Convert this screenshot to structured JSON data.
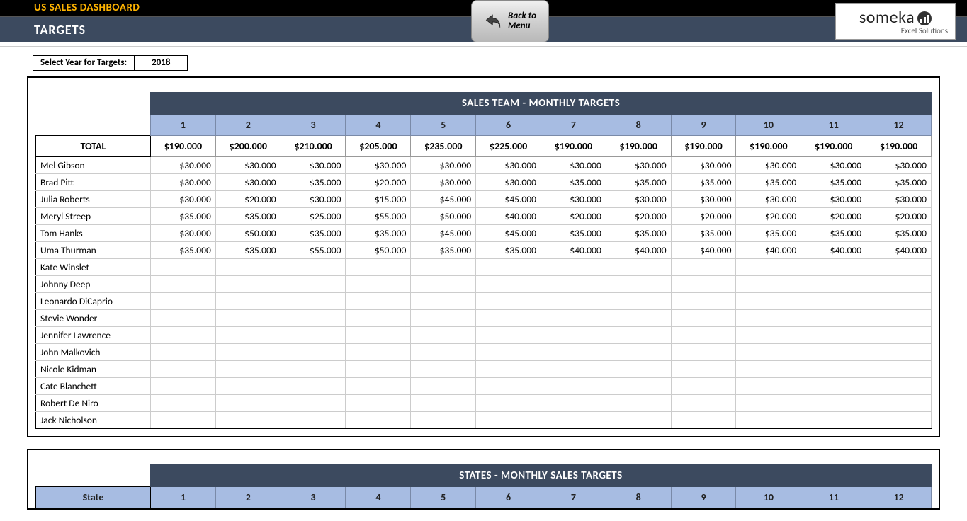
{
  "header": {
    "title": "US SALES DASHBOARD",
    "subtitle": "TARGETS",
    "back_button_line1": "Back to",
    "back_button_line2": "Menu",
    "logo_name": "someka",
    "logo_tagline": "Excel Solutions"
  },
  "year_selector": {
    "label": "Select Year for Targets:",
    "value": "2018"
  },
  "table1": {
    "title": "SALES TEAM - MONTHLY TARGETS",
    "months": [
      "1",
      "2",
      "3",
      "4",
      "5",
      "6",
      "7",
      "8",
      "9",
      "10",
      "11",
      "12"
    ],
    "total_label": "TOTAL",
    "totals": [
      "$190.000",
      "$200.000",
      "$210.000",
      "$205.000",
      "$235.000",
      "$225.000",
      "$190.000",
      "$190.000",
      "$190.000",
      "$190.000",
      "$190.000",
      "$190.000"
    ],
    "rows": [
      {
        "name": "Mel Gibson",
        "vals": [
          "$30.000",
          "$30.000",
          "$30.000",
          "$30.000",
          "$30.000",
          "$30.000",
          "$30.000",
          "$30.000",
          "$30.000",
          "$30.000",
          "$30.000",
          "$30.000"
        ]
      },
      {
        "name": "Brad Pitt",
        "vals": [
          "$30.000",
          "$30.000",
          "$35.000",
          "$20.000",
          "$30.000",
          "$30.000",
          "$35.000",
          "$35.000",
          "$35.000",
          "$35.000",
          "$35.000",
          "$35.000"
        ]
      },
      {
        "name": "Julia Roberts",
        "vals": [
          "$30.000",
          "$20.000",
          "$30.000",
          "$15.000",
          "$45.000",
          "$45.000",
          "$30.000",
          "$30.000",
          "$30.000",
          "$30.000",
          "$30.000",
          "$30.000"
        ]
      },
      {
        "name": "Meryl Streep",
        "vals": [
          "$35.000",
          "$35.000",
          "$25.000",
          "$55.000",
          "$50.000",
          "$40.000",
          "$20.000",
          "$20.000",
          "$20.000",
          "$20.000",
          "$20.000",
          "$20.000"
        ]
      },
      {
        "name": "Tom Hanks",
        "vals": [
          "$30.000",
          "$50.000",
          "$35.000",
          "$35.000",
          "$45.000",
          "$45.000",
          "$35.000",
          "$35.000",
          "$35.000",
          "$35.000",
          "$35.000",
          "$35.000"
        ]
      },
      {
        "name": "Uma Thurman",
        "vals": [
          "$35.000",
          "$35.000",
          "$55.000",
          "$50.000",
          "$35.000",
          "$35.000",
          "$40.000",
          "$40.000",
          "$40.000",
          "$40.000",
          "$40.000",
          "$40.000"
        ]
      },
      {
        "name": "Kate Winslet",
        "vals": [
          "",
          "",
          "",
          "",
          "",
          "",
          "",
          "",
          "",
          "",
          "",
          ""
        ]
      },
      {
        "name": "Johnny Deep",
        "vals": [
          "",
          "",
          "",
          "",
          "",
          "",
          "",
          "",
          "",
          "",
          "",
          ""
        ]
      },
      {
        "name": "Leonardo DiCaprio",
        "vals": [
          "",
          "",
          "",
          "",
          "",
          "",
          "",
          "",
          "",
          "",
          "",
          ""
        ]
      },
      {
        "name": "Stevie Wonder",
        "vals": [
          "",
          "",
          "",
          "",
          "",
          "",
          "",
          "",
          "",
          "",
          "",
          ""
        ]
      },
      {
        "name": "Jennifer Lawrence",
        "vals": [
          "",
          "",
          "",
          "",
          "",
          "",
          "",
          "",
          "",
          "",
          "",
          ""
        ]
      },
      {
        "name": "John Malkovich",
        "vals": [
          "",
          "",
          "",
          "",
          "",
          "",
          "",
          "",
          "",
          "",
          "",
          ""
        ]
      },
      {
        "name": "Nicole Kidman",
        "vals": [
          "",
          "",
          "",
          "",
          "",
          "",
          "",
          "",
          "",
          "",
          "",
          ""
        ]
      },
      {
        "name": "Cate Blanchett",
        "vals": [
          "",
          "",
          "",
          "",
          "",
          "",
          "",
          "",
          "",
          "",
          "",
          ""
        ]
      },
      {
        "name": "Robert De Niro",
        "vals": [
          "",
          "",
          "",
          "",
          "",
          "",
          "",
          "",
          "",
          "",
          "",
          ""
        ]
      },
      {
        "name": "Jack Nicholson",
        "vals": [
          "",
          "",
          "",
          "",
          "",
          "",
          "",
          "",
          "",
          "",
          "",
          ""
        ]
      }
    ]
  },
  "table2": {
    "title": "STATES - MONTHLY SALES TARGETS",
    "state_label": "State",
    "months": [
      "1",
      "2",
      "3",
      "4",
      "5",
      "6",
      "7",
      "8",
      "9",
      "10",
      "11",
      "12"
    ]
  }
}
